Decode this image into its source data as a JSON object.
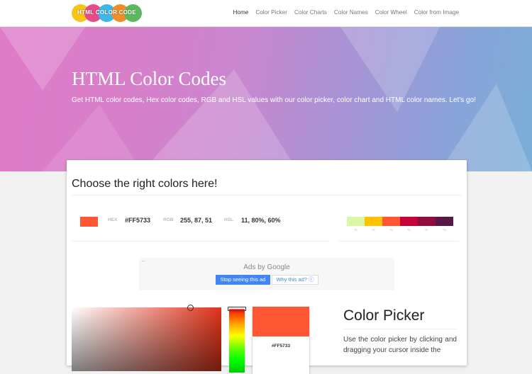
{
  "nav": {
    "logo_text": "HTML COLOR CODE",
    "logo_colors": [
      "#f5c518",
      "#e84a8a",
      "#3fb6e8",
      "#f28c28",
      "#5cb85c"
    ],
    "items": [
      {
        "label": "Home",
        "active": true
      },
      {
        "label": "Color Picker",
        "active": false
      },
      {
        "label": "Color Charts",
        "active": false
      },
      {
        "label": "Color Names",
        "active": false
      },
      {
        "label": "Color Wheel",
        "active": false
      },
      {
        "label": "Color from Image",
        "active": false
      }
    ]
  },
  "hero": {
    "title": "HTML Color Codes",
    "subtitle": "Get HTML color codes, Hex color codes, RGB and HSL values with our color picker, color chart and HTML color names. Let's go!"
  },
  "card": {
    "heading": "Choose the right colors here!",
    "selected_color": "#FF5733",
    "hex_label": "HEX",
    "hex_value": "#FF5733",
    "rgb_label": "RGB",
    "rgb_value": "255, 87, 51",
    "hsl_label": "HSL",
    "hsl_value": "11, 80%, 60%",
    "palette": [
      {
        "color": "#daf7a6",
        "caption": "%"
      },
      {
        "color": "#ffc300",
        "caption": "%"
      },
      {
        "color": "#ff5733",
        "caption": "%"
      },
      {
        "color": "#c70039",
        "caption": "%"
      },
      {
        "color": "#900c3f",
        "caption": "%"
      },
      {
        "color": "#581845",
        "caption": "%"
      }
    ]
  },
  "ad": {
    "back_icon": "←",
    "ads_by": "Ads by Google",
    "stop_label": "Stop seeing this ad",
    "why_label": "Why this ad? ⓘ"
  },
  "picker": {
    "preview_hex": "#FF5733",
    "preview_sub": "",
    "title": "Color Picker",
    "description": "Use the color picker by clicking and dragging your cursor inside the"
  }
}
